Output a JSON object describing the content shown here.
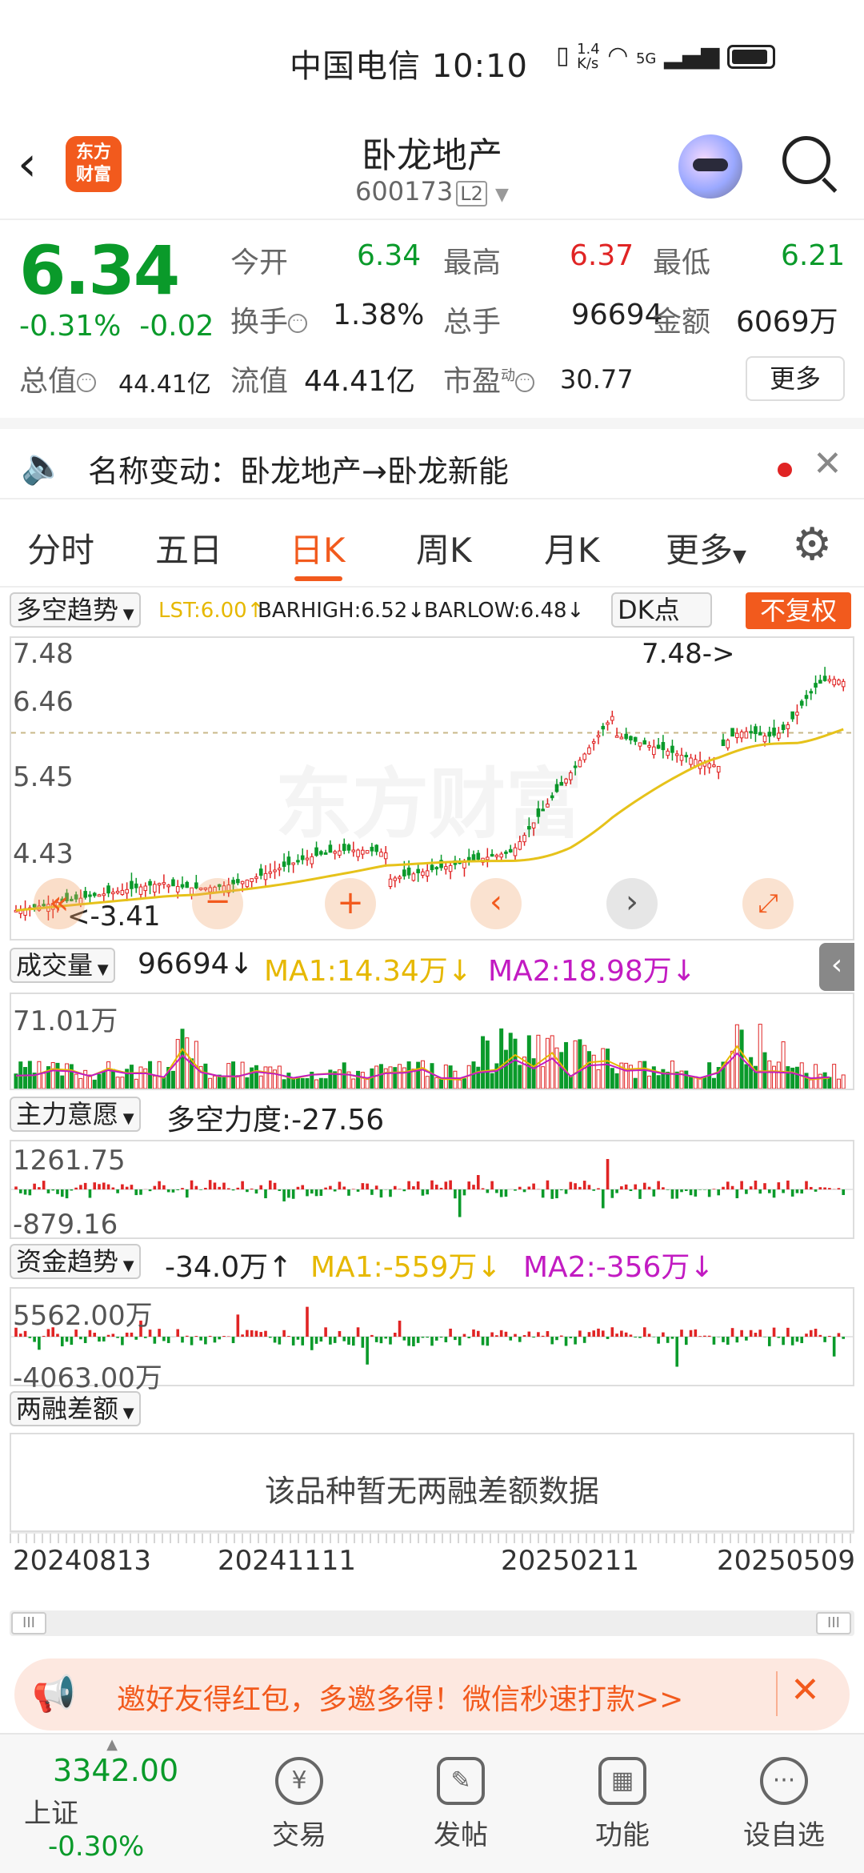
{
  "status_bar": {
    "carrier_time": "中国电信 10:10",
    "net_speed": "1.4\nK/s",
    "signal": "5G"
  },
  "header": {
    "title": "卧龙地产",
    "code": "600173",
    "level_badge": "L2",
    "logo_text": "东方\n财富"
  },
  "quote": {
    "price": "6.34",
    "change_pct": "-0.31%",
    "change_abs": "-0.02",
    "open_label": "今开",
    "open": "6.34",
    "high_label": "最高",
    "high": "6.37",
    "low_label": "最低",
    "low": "6.21",
    "turnover_label": "换手",
    "turnover": "1.38%",
    "volume_label": "总手",
    "volume": "96694",
    "amount_label": "金额",
    "amount": "6069万",
    "mktcap_label": "总值",
    "mktcap": "44.41亿",
    "float_label": "流值",
    "float_cap": "44.41亿",
    "pe_label": "市盈",
    "pe_sup": "动",
    "pe": "30.77",
    "more": "更多"
  },
  "notice": {
    "text": "名称变动：卧龙地产→卧龙新能"
  },
  "tabs": [
    "分时",
    "五日",
    "日K",
    "周K",
    "月K",
    "更多"
  ],
  "active_tab": "日K",
  "kline": {
    "indicator_select": "多空趋势",
    "lst": "LST:6.00↑",
    "barhigh": "BARHIGH:6.52↓",
    "barlow": "BARLOW:6.48↓",
    "dk_button": "DK点",
    "adjust_button": "不复权",
    "y_labels": [
      "7.48",
      "6.46",
      "5.45",
      "4.43"
    ],
    "max_marker": "7.48->",
    "min_marker": "<-3.41",
    "watermark": "东方财富"
  },
  "volume": {
    "select": "成交量",
    "value": "96694↓",
    "ma1": "MA1:14.34万↓",
    "ma2": "MA2:18.98万↓",
    "y_max": "71.01万"
  },
  "main_force": {
    "select": "主力意愿",
    "label": "多空力度:-27.56",
    "y_max": "1261.75",
    "y_min": "-879.16"
  },
  "fund_trend": {
    "select": "资金趋势",
    "value": "-34.0万↑",
    "ma1": "MA1:-559万↓",
    "ma2": "MA2:-356万↓",
    "y_max": "5562.00万",
    "y_min": "-4063.00万"
  },
  "margin": {
    "select": "两融差额",
    "empty_text": "该品种暂无两融差额数据"
  },
  "x_dates": [
    "20240813",
    "20241111",
    "20250211",
    "20250509"
  ],
  "promo": {
    "text": "邀好友得红包，多邀多得！微信秒速打款>>"
  },
  "bottom_nav": {
    "index_value": "3342.00",
    "index_name": "上证",
    "index_change": "-0.30%",
    "items": [
      "交易",
      "发帖",
      "功能",
      "设自选"
    ]
  },
  "colors": {
    "up": "#e02424",
    "down": "#0a9a2a",
    "accent": "#f25a1d",
    "ma1": "#e6b800",
    "ma2": "#c21bc2"
  }
}
